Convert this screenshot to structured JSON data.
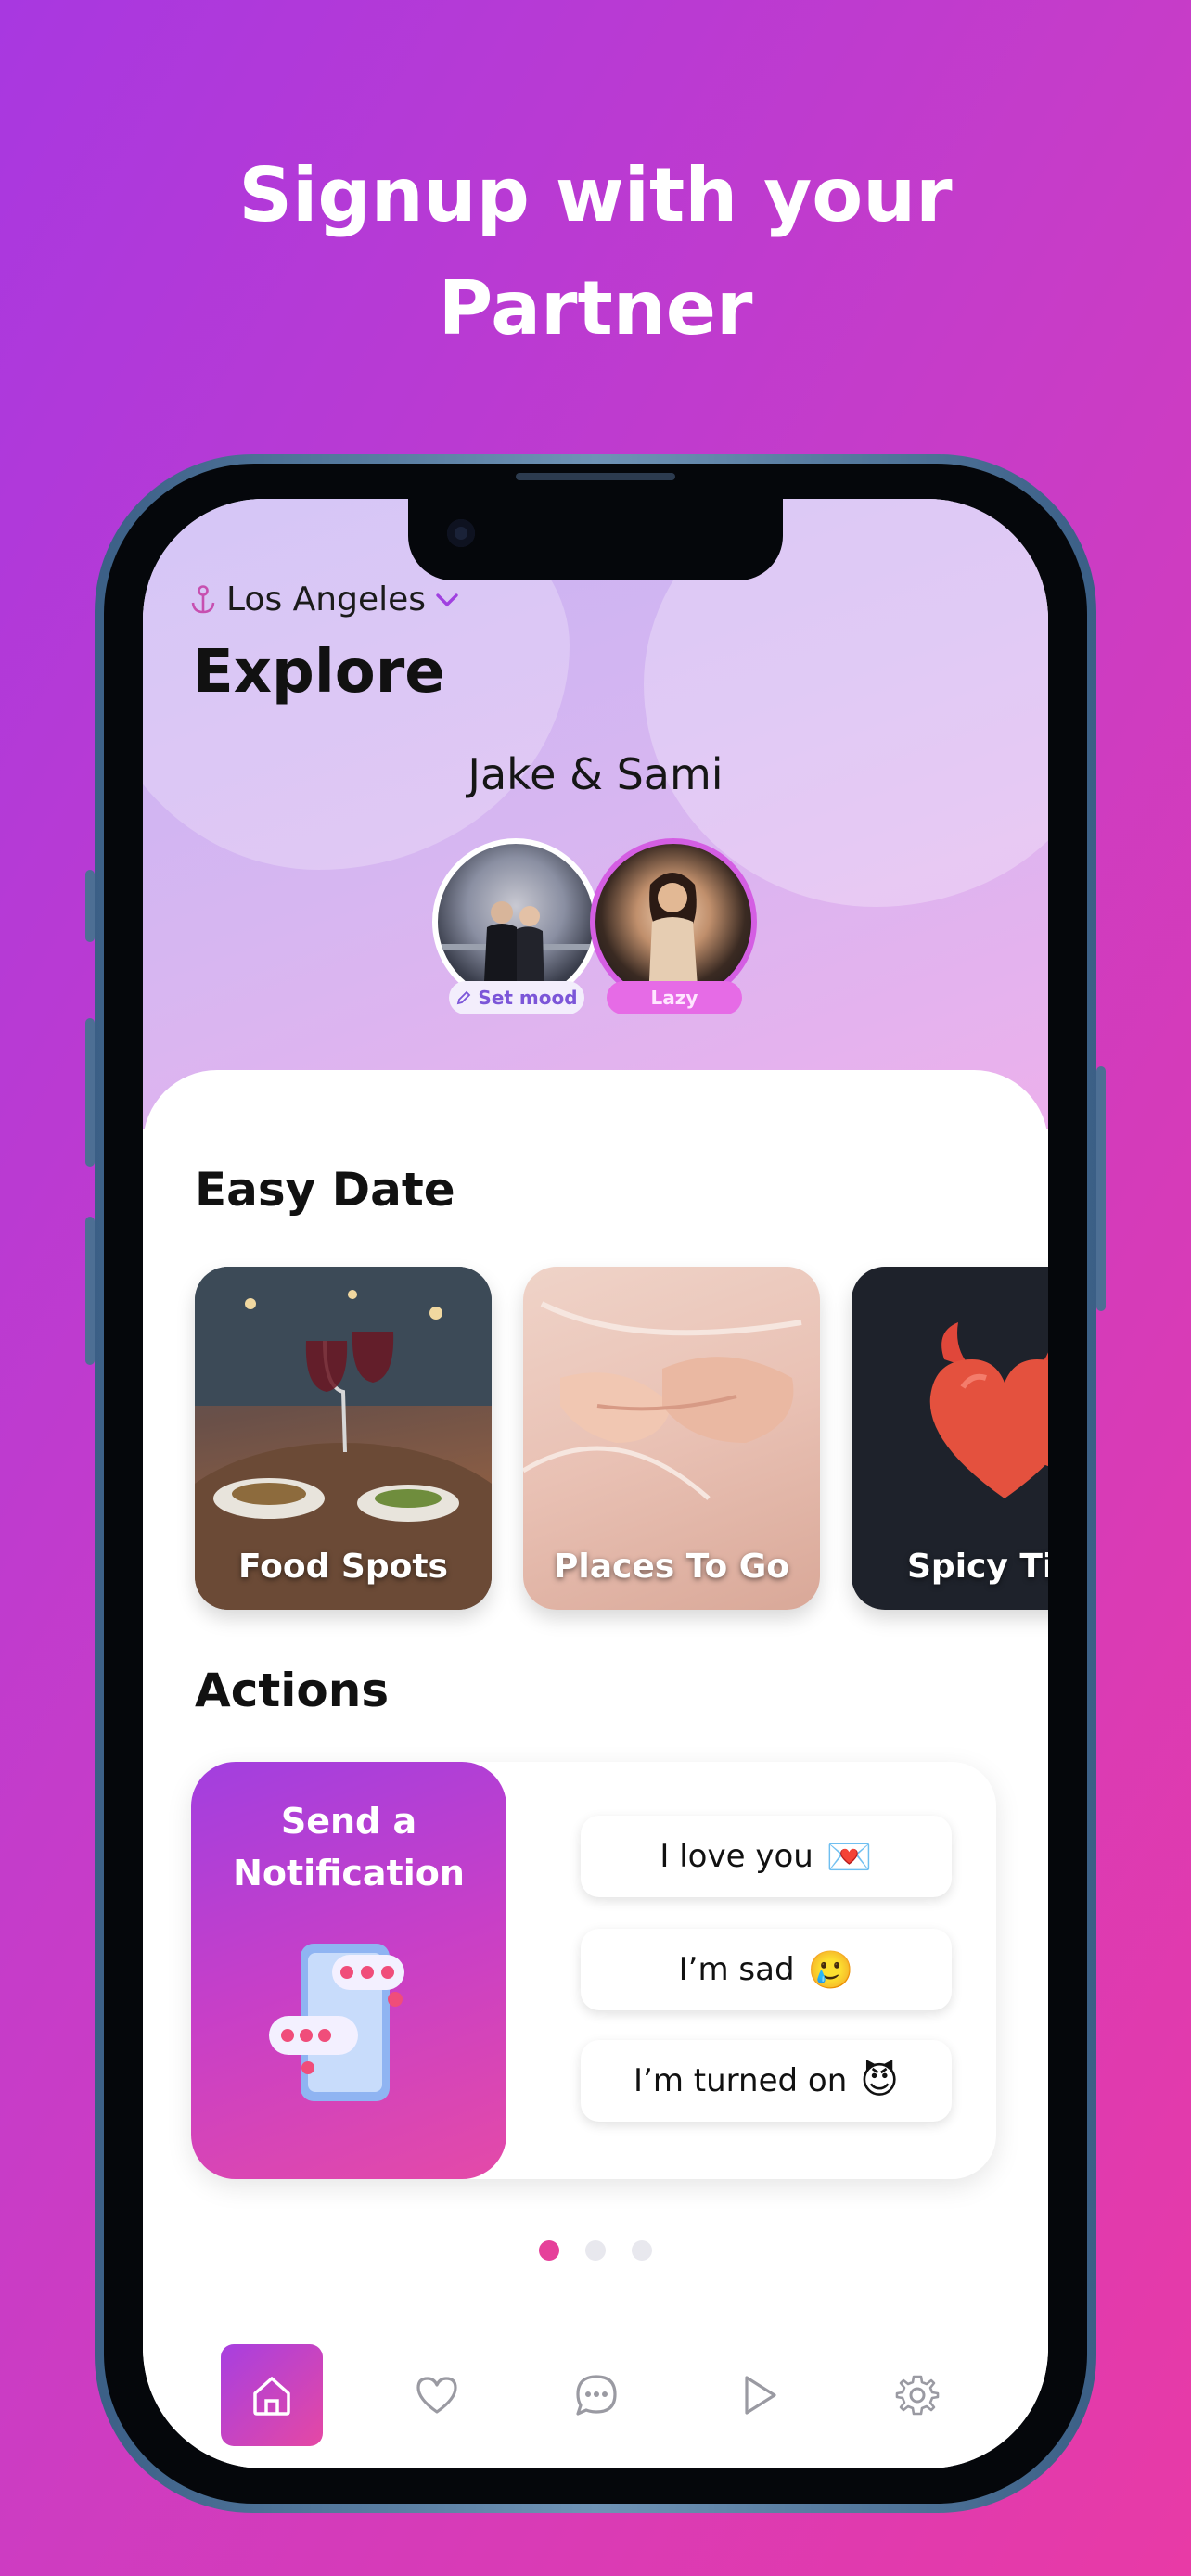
{
  "headline": {
    "line1": "Signup with your",
    "line2": "Partner"
  },
  "location": {
    "city": "Los Angeles"
  },
  "page_title": "Explore",
  "couple": {
    "names": "Jake & Sami",
    "mood_left": "Set mood",
    "mood_right": "Lazy"
  },
  "easy_date": {
    "title": "Easy Date",
    "cards": [
      {
        "label": "Food Spots"
      },
      {
        "label": "Places To Go"
      },
      {
        "label": "Spicy Tii"
      }
    ]
  },
  "actions": {
    "title": "Actions",
    "notify_line1": "Send a",
    "notify_line2": "Notification",
    "quick": [
      {
        "label": "I love you",
        "emoji": "💌"
      },
      {
        "label": "I’m sad",
        "emoji": "🥲"
      },
      {
        "label": "I’m turned on",
        "emoji": "😈"
      }
    ]
  },
  "pagination": {
    "current": 1,
    "total": 3
  },
  "tabs": [
    "home-icon",
    "heart-icon",
    "chat-icon",
    "play-icon",
    "gear-icon"
  ],
  "colors": {
    "accent": "#e6409a",
    "purple": "#a73fe0"
  }
}
